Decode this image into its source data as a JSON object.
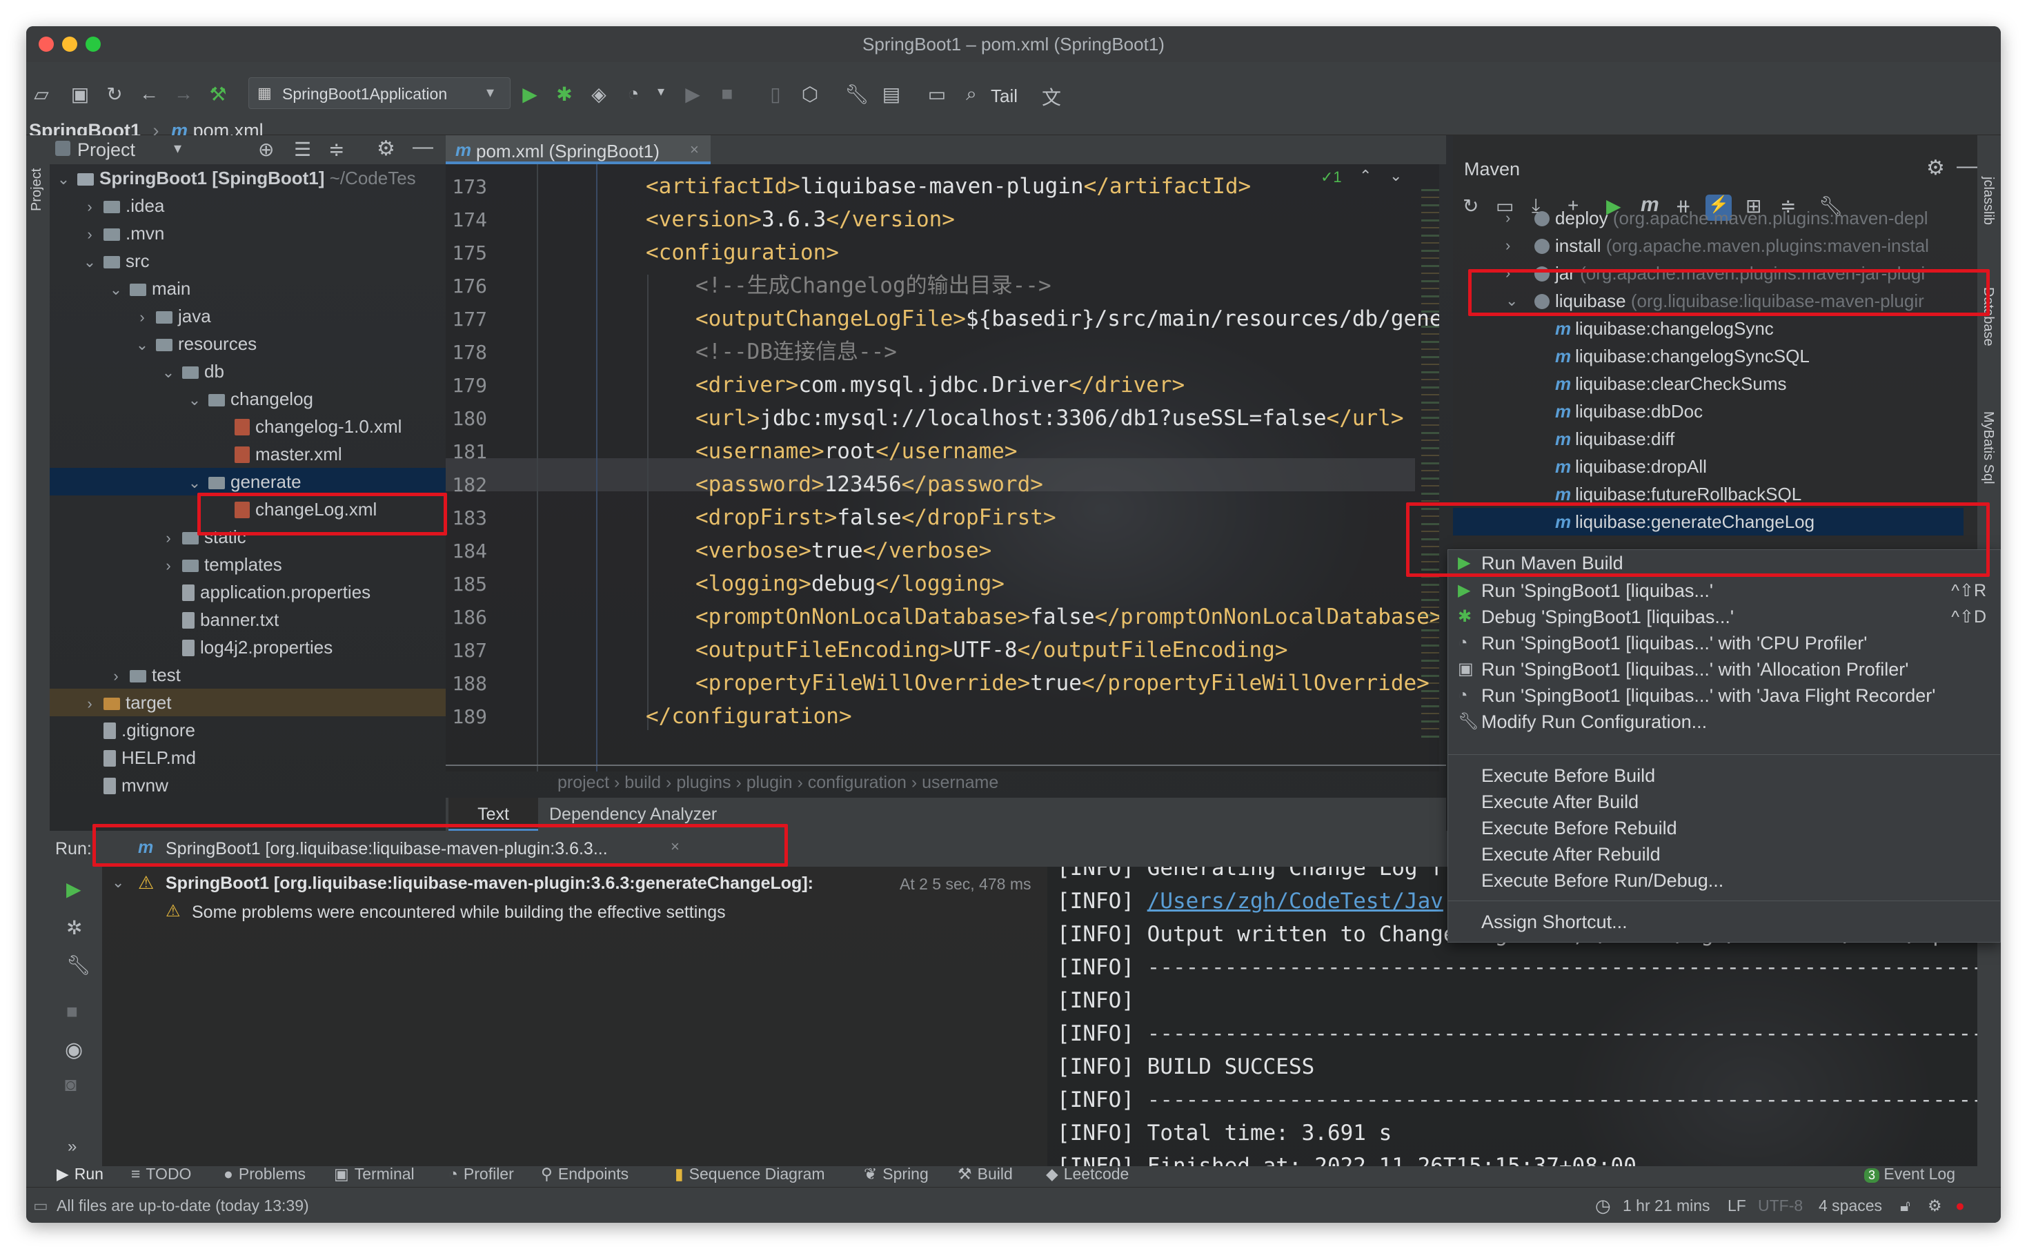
{
  "window": {
    "title": "SpringBoot1 – pom.xml (SpringBoot1)"
  },
  "toolbar": {
    "run_config": "SpringBoot1Application",
    "tail_label": "Tail"
  },
  "breadcrumb": {
    "project": "SpringBoot1",
    "file": "pom.xml"
  },
  "project_panel": {
    "title": "Project",
    "rows": [
      {
        "label": "SpringBoot1 [SpingBoot1]",
        "suffix": " ~/CodeTes",
        "kind": "root"
      },
      {
        "label": ".idea",
        "kind": "folder"
      },
      {
        "label": ".mvn",
        "kind": "folder"
      },
      {
        "label": "src",
        "kind": "folder"
      },
      {
        "label": "main",
        "kind": "folder"
      },
      {
        "label": "java",
        "kind": "folder"
      },
      {
        "label": "resources",
        "kind": "folder"
      },
      {
        "label": "db",
        "kind": "folder"
      },
      {
        "label": "changelog",
        "kind": "folder"
      },
      {
        "label": "changelog-1.0.xml",
        "kind": "xml"
      },
      {
        "label": "master.xml",
        "kind": "xml"
      },
      {
        "label": "generate",
        "kind": "folder"
      },
      {
        "label": "changeLog.xml",
        "kind": "xml"
      },
      {
        "label": "static",
        "kind": "folder"
      },
      {
        "label": "templates",
        "kind": "folder"
      },
      {
        "label": "application.properties",
        "kind": "file"
      },
      {
        "label": "banner.txt",
        "kind": "file"
      },
      {
        "label": "log4j2.properties",
        "kind": "file"
      },
      {
        "label": "test",
        "kind": "folder"
      },
      {
        "label": "target",
        "kind": "folder"
      },
      {
        "label": ".gitignore",
        "kind": "file"
      },
      {
        "label": "HELP.md",
        "kind": "file"
      },
      {
        "label": "mvnw",
        "kind": "file"
      }
    ]
  },
  "editor": {
    "tab": "pom.xml (SpringBoot1)",
    "inspection": "✓1",
    "lines": [
      {
        "n": "173",
        "text": "<artifactId>liquibase-maven-plugin</artifactId>"
      },
      {
        "n": "174",
        "text": "<version>3.6.3</version>"
      },
      {
        "n": "175",
        "text": "<configuration>"
      },
      {
        "n": "176",
        "text": "<!--生成Changelog的输出目录-->"
      },
      {
        "n": "177",
        "text": "<outputChangeLogFile>${basedir}/src/main/resources/db/gene"
      },
      {
        "n": "178",
        "text": "<!--DB连接信息-->"
      },
      {
        "n": "179",
        "text": "<driver>com.mysql.jdbc.Driver</driver>"
      },
      {
        "n": "180",
        "text": "<url>jdbc:mysql://localhost:3306/db1?useSSL=false</url>"
      },
      {
        "n": "181",
        "text": "<username>root</username>"
      },
      {
        "n": "182",
        "text": "<password>123456</password>"
      },
      {
        "n": "183",
        "text": "<dropFirst>false</dropFirst>"
      },
      {
        "n": "184",
        "text": "<verbose>true</verbose>"
      },
      {
        "n": "185",
        "text": "<logging>debug</logging>"
      },
      {
        "n": "186",
        "text": "<promptOnNonLocalDatabase>false</promptOnNonLocalDatabase>"
      },
      {
        "n": "187",
        "text": "<outputFileEncoding>UTF-8</outputFileEncoding>"
      },
      {
        "n": "188",
        "text": "<propertyFileWillOverride>true</propertyFileWillOverride>"
      },
      {
        "n": "189",
        "text": "</configuration>"
      }
    ],
    "path": [
      "project",
      "build",
      "plugins",
      "plugin",
      "configuration",
      "username"
    ],
    "bottom_tabs": [
      "Text",
      "Dependency Analyzer"
    ]
  },
  "maven": {
    "title": "Maven",
    "rows": [
      {
        "name": "deploy",
        "detail": " (org.apache.maven.plugins:maven-depl"
      },
      {
        "name": "install",
        "detail": " (org.apache.maven.plugins:maven-instal"
      },
      {
        "name": "jar",
        "detail": " (org.apache.maven.plugins:maven-jar-plugi"
      },
      {
        "name": "liquibase",
        "detail": " (org.liquibase:liquibase-maven-plugir"
      },
      {
        "name": "liquibase:changelogSync",
        "detail": ""
      },
      {
        "name": "liquibase:changelogSyncSQL",
        "detail": ""
      },
      {
        "name": "liquibase:clearCheckSums",
        "detail": ""
      },
      {
        "name": "liquibase:dbDoc",
        "detail": ""
      },
      {
        "name": "liquibase:diff",
        "detail": ""
      },
      {
        "name": "liquibase:dropAll",
        "detail": ""
      },
      {
        "name": "liquibase:futureRollbackSQL",
        "detail": ""
      },
      {
        "name": "liquibase:generateChangeLog",
        "detail": ""
      }
    ],
    "side_tabs": [
      "jclasslib",
      "Database",
      "MyBatis Sql"
    ]
  },
  "context_menu": {
    "run_maven_build": "Run Maven Build",
    "items": [
      {
        "label": "Run 'SpingBoot1 [liquibas...'",
        "shortcut": "^⇧R"
      },
      {
        "label": "Debug 'SpingBoot1 [liquibas...'",
        "shortcut": "^⇧D"
      },
      {
        "label": "Run 'SpingBoot1 [liquibas...' with 'CPU Profiler'",
        "shortcut": ""
      },
      {
        "label": "Run 'SpingBoot1 [liquibas...' with 'Allocation Profiler'",
        "shortcut": ""
      },
      {
        "label": "Run 'SpingBoot1 [liquibas...' with 'Java Flight Recorder'",
        "shortcut": ""
      },
      {
        "label": "Modify Run Configuration...",
        "shortcut": ""
      }
    ],
    "execute": [
      "Execute Before Build",
      "Execute After Build",
      "Execute Before Rebuild",
      "Execute After Rebuild",
      "Execute Before Run/Debug..."
    ],
    "assign": "Assign Shortcut..."
  },
  "run_panel": {
    "label": "Run:",
    "tab": "SpringBoot1 [org.liquibase:liquibase-maven-plugin:3.6.3...",
    "tree_title": "SpringBoot1 [org.liquibase:liquibase-maven-plugin:3.6.3:generateChangeLog]:",
    "tree_time": "At 2 5 sec, 478 ms",
    "tree_warning": "Some problems were encountered while building the effective settings",
    "console": [
      {
        "prefix": "[INFO]",
        "text": "Generating Change Log f"
      },
      {
        "prefix": "[INFO]",
        "text": "/Users/zgh/CodeTest/Jav",
        "link": true
      },
      {
        "prefix": "[INFO]",
        "text": "Output written to Change Log file, /Users/zgh/CodeTest/Java/Sp"
      },
      {
        "prefix": "[INFO]",
        "text": "------------------------------------------------------------------------"
      },
      {
        "prefix": "[INFO]",
        "text": ""
      },
      {
        "prefix": "[INFO]",
        "text": "------------------------------------------------------------------------"
      },
      {
        "prefix": "[INFO]",
        "text": "BUILD SUCCESS"
      },
      {
        "prefix": "[INFO]",
        "text": "------------------------------------------------------------------------"
      },
      {
        "prefix": "[INFO]",
        "text": "Total time:  3.691 s"
      },
      {
        "prefix": "[INFO]",
        "text": "Finished at: 2022-11-26T15:15:37+08:00"
      }
    ]
  },
  "bottom_tabs": [
    {
      "label": "Run",
      "icon": "▶"
    },
    {
      "label": "TODO",
      "icon": "≡"
    },
    {
      "label": "Problems",
      "icon": "●"
    },
    {
      "label": "Terminal",
      "icon": "▣"
    },
    {
      "label": "Profiler",
      "icon": "◔"
    },
    {
      "label": "Endpoints",
      "icon": "⚲"
    },
    {
      "label": "Sequence Diagram",
      "icon": "▮"
    },
    {
      "label": "Spring",
      "icon": "❦"
    },
    {
      "label": "Build",
      "icon": "⚒"
    },
    {
      "label": "Leetcode",
      "icon": "◆"
    }
  ],
  "event_log": {
    "count": "3",
    "label": "Event Log"
  },
  "status": {
    "message": "All files are up-to-date (today 13:39)",
    "time": "1 hr 21 mins",
    "line_sep": "LF",
    "encoding": "UTF-8",
    "indent": "4 spaces"
  },
  "colors": {
    "highlight_red": "#e0141e",
    "tag": "#e8bf6a",
    "comment": "#808080",
    "run_green": "#4eb84f"
  }
}
